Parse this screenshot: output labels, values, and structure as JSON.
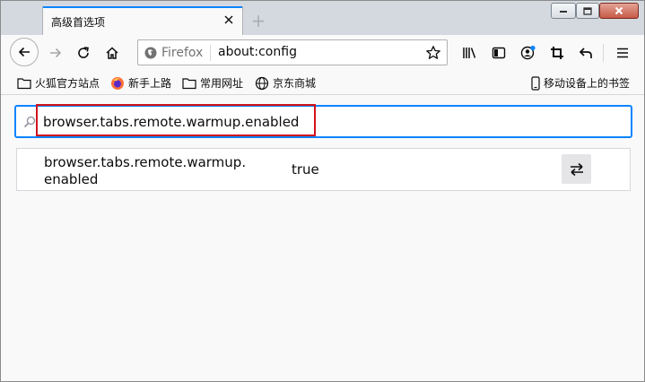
{
  "tab": {
    "title": "高级首选项"
  },
  "urlbar": {
    "identity_label": "Firefox",
    "url": "about:config"
  },
  "bookmarks": {
    "items": [
      {
        "label": "火狐官方站点",
        "icon": "folder-icon"
      },
      {
        "label": "新手上路",
        "icon": "firefox-logo-icon"
      },
      {
        "label": "常用网址",
        "icon": "folder-icon"
      },
      {
        "label": "京东商城",
        "icon": "globe-icon"
      }
    ],
    "mobile_label": "移动设备上的书签"
  },
  "search": {
    "value": "browser.tabs.remote.warmup.enabled"
  },
  "prefs": [
    {
      "name_line1": "browser.tabs.remote.warmup.",
      "name_line2": "enabled",
      "value": "true"
    }
  ],
  "colors": {
    "accent": "#0a84ff",
    "highlight": "#d0121d",
    "tab_strip": "#d4d9e0"
  }
}
